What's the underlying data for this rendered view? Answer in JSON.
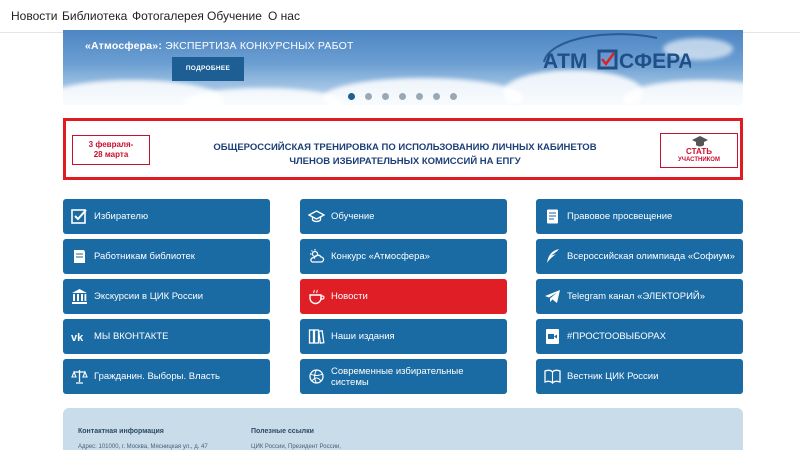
{
  "nav": [
    "Новости",
    "Библиотека",
    "Фотогалерея",
    "Обучение",
    "О нас"
  ],
  "banner": {
    "title_bold": "«Атмосфера»:",
    "title_rest": " ЭКСПЕРТИЗА КОНКУРСНЫХ РАБОТ",
    "button": "ПОДРОБНЕЕ",
    "logo_text_a": "АТМ",
    "logo_text_b": "СФЕРА",
    "slides": 7,
    "active_slide": 1
  },
  "promo": {
    "dates_line1": "3 февраля-",
    "dates_line2": "28 марта",
    "line1": "ОБЩЕРОССИЙСКАЯ ТРЕНИРОВКА ПО ИСПОЛЬЗОВАНИЮ ЛИЧНЫХ КАБИНЕТОВ",
    "line2": "ЧЛЕНОВ ИЗБИРАТЕЛЬНЫХ КОМИССИЙ НА ЕПГУ",
    "cta_line1": "СТАТЬ",
    "cta_line2": "УЧАСТНИКОМ"
  },
  "tiles": [
    {
      "label": "Избирателю",
      "icon": "checkbox-icon"
    },
    {
      "label": "Обучение",
      "icon": "graduation-cap-icon"
    },
    {
      "label": "Правовое просвещение",
      "icon": "book-icon"
    },
    {
      "label": "Работникам библиотек",
      "icon": "book-open-icon"
    },
    {
      "label": "Конкурс «Атмосфера»",
      "icon": "weather-cloud-icon"
    },
    {
      "label": "Всероссийская олимпиада «Софиум»",
      "icon": "quill-icon"
    },
    {
      "label": "Экскурсии в ЦИК России",
      "icon": "institution-icon"
    },
    {
      "label": "Новости",
      "icon": "coffee-cup-icon",
      "highlight": "#e01e26"
    },
    {
      "label": "Telegram канал «ЭЛЕКТОРИЙ»",
      "icon": "telegram-icon"
    },
    {
      "label": "МЫ ВКОНТАКТЕ",
      "icon": "vk-icon"
    },
    {
      "label": "Наши издания",
      "icon": "books-icon"
    },
    {
      "label": "#ПРОСТООВЫБОРАХ",
      "icon": "video-camera-icon"
    },
    {
      "label": "Гражданин. Выборы. Власть",
      "icon": "scales-icon"
    },
    {
      "label": "Современные избирательные системы",
      "icon": "ball-icon"
    },
    {
      "label": "Вестник ЦИК России",
      "icon": "open-book-icon"
    }
  ],
  "footer": {
    "contact_title": "Контактная информация",
    "contact_text": "Адрес: 101000, г. Москва, Мясницкая ул., д. 47",
    "links_title": "Полезные ссылки",
    "links_text": "ЦИК России, Президент России,"
  },
  "colors": {
    "tile": "#1a6aa3",
    "tile_highlight": "#e01e26",
    "promo_border": "#e11b22",
    "footer": "#c8dcea"
  }
}
